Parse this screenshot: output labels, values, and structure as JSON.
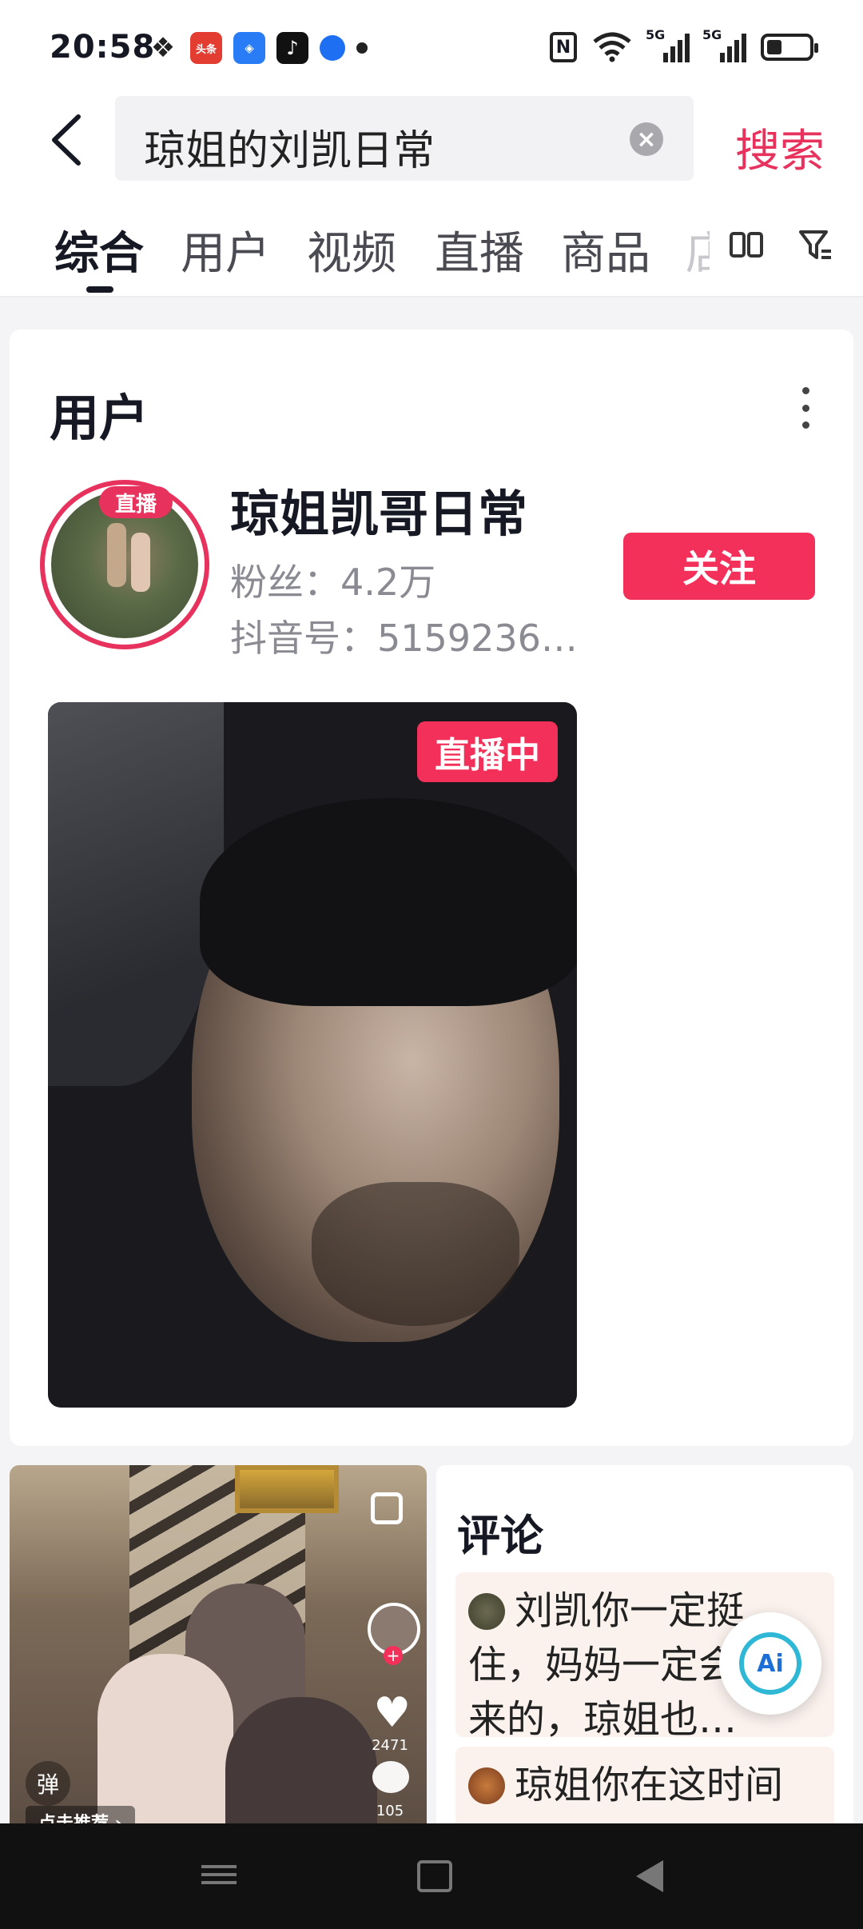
{
  "status_bar": {
    "time": "20:58",
    "notification_icons": [
      "wechat-icon",
      "toutiao-icon",
      "ai-search-icon",
      "tiktok-icon",
      "browser-icon",
      "dot-icon"
    ],
    "toutiao_label": "头条",
    "nfc_label": "N",
    "signal_labels": [
      "5G",
      "5G"
    ],
    "battery_level": 0.35
  },
  "search": {
    "query": "琼姐的刘凯日常",
    "search_button": "搜索"
  },
  "tabs": {
    "items": [
      "综合",
      "用户",
      "视频",
      "直播",
      "商品"
    ],
    "partial_item": "店",
    "active_index": 0
  },
  "user_section": {
    "title": "用户",
    "user": {
      "live_tag": "直播",
      "name": "琼姐凯哥日常",
      "fans": "粉丝：4.2万",
      "douyin_id": "抖音号：5159236…",
      "follow_label": "关注"
    },
    "live_badge": "直播中"
  },
  "video_card": {
    "danmu_label": "弹",
    "recommend_label": "点击推荐 ›",
    "likes": "2471",
    "comments": "105"
  },
  "comments_card": {
    "title": "评论",
    "items": [
      {
        "text": "刘凯你一定挺住，妈妈一定会好起来的，琼姐也…"
      },
      {
        "text": "琼姐你在这时间"
      }
    ]
  },
  "ai_button": {
    "label": "Ai"
  }
}
